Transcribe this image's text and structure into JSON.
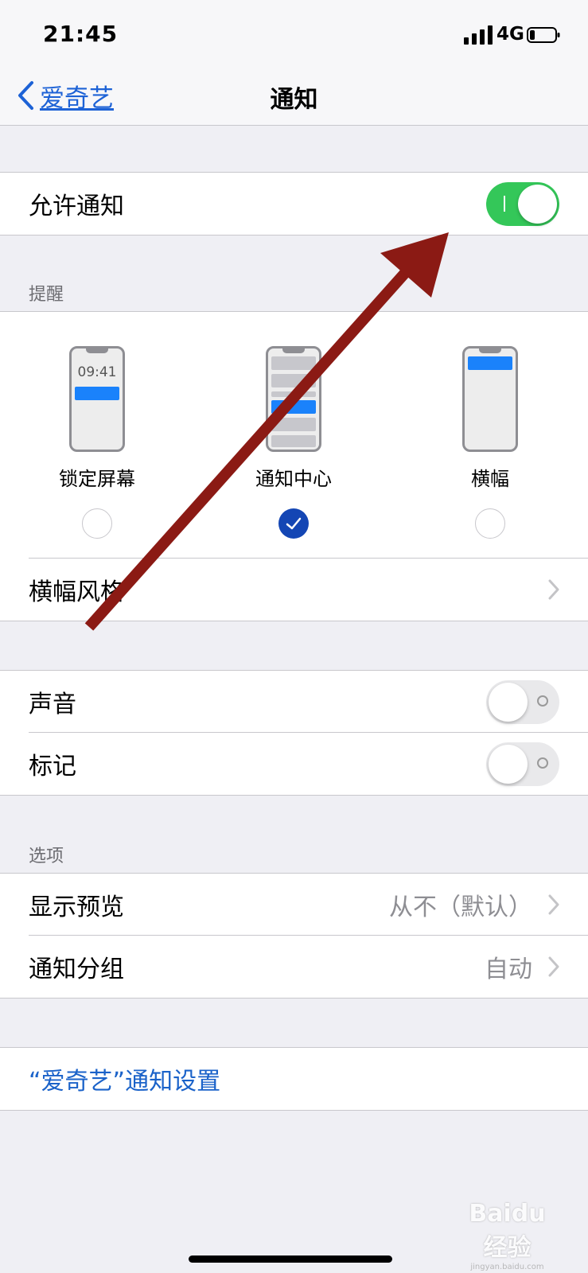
{
  "status_bar": {
    "time": "21:45",
    "network": "4G"
  },
  "nav": {
    "back_label": "爱奇艺",
    "title": "通知"
  },
  "allow_notifications": {
    "label": "允许通知",
    "enabled": true
  },
  "alerts": {
    "header": "提醒",
    "options": [
      {
        "label": "锁定屏幕",
        "phone_time": "09:41",
        "selected": false
      },
      {
        "label": "通知中心",
        "selected": true
      },
      {
        "label": "横幅",
        "selected": false
      }
    ],
    "banner_style_label": "横幅风格"
  },
  "sounds": {
    "label": "声音",
    "enabled": false
  },
  "badges": {
    "label": "标记",
    "enabled": false
  },
  "options": {
    "header": "选项",
    "show_previews": {
      "label": "显示预览",
      "value": "从不（默认）"
    },
    "grouping": {
      "label": "通知分组",
      "value": "自动"
    }
  },
  "app_settings_link": "“爱奇艺”通知设置",
  "colors": {
    "accent_blue": "#1d62d6",
    "switch_on": "#34c759",
    "checkmark_fill": "#1446b4",
    "annotation_arrow": "#8b1a14"
  },
  "watermark": {
    "logo": "Baidu经验",
    "url": "jingyan.baidu.com"
  }
}
